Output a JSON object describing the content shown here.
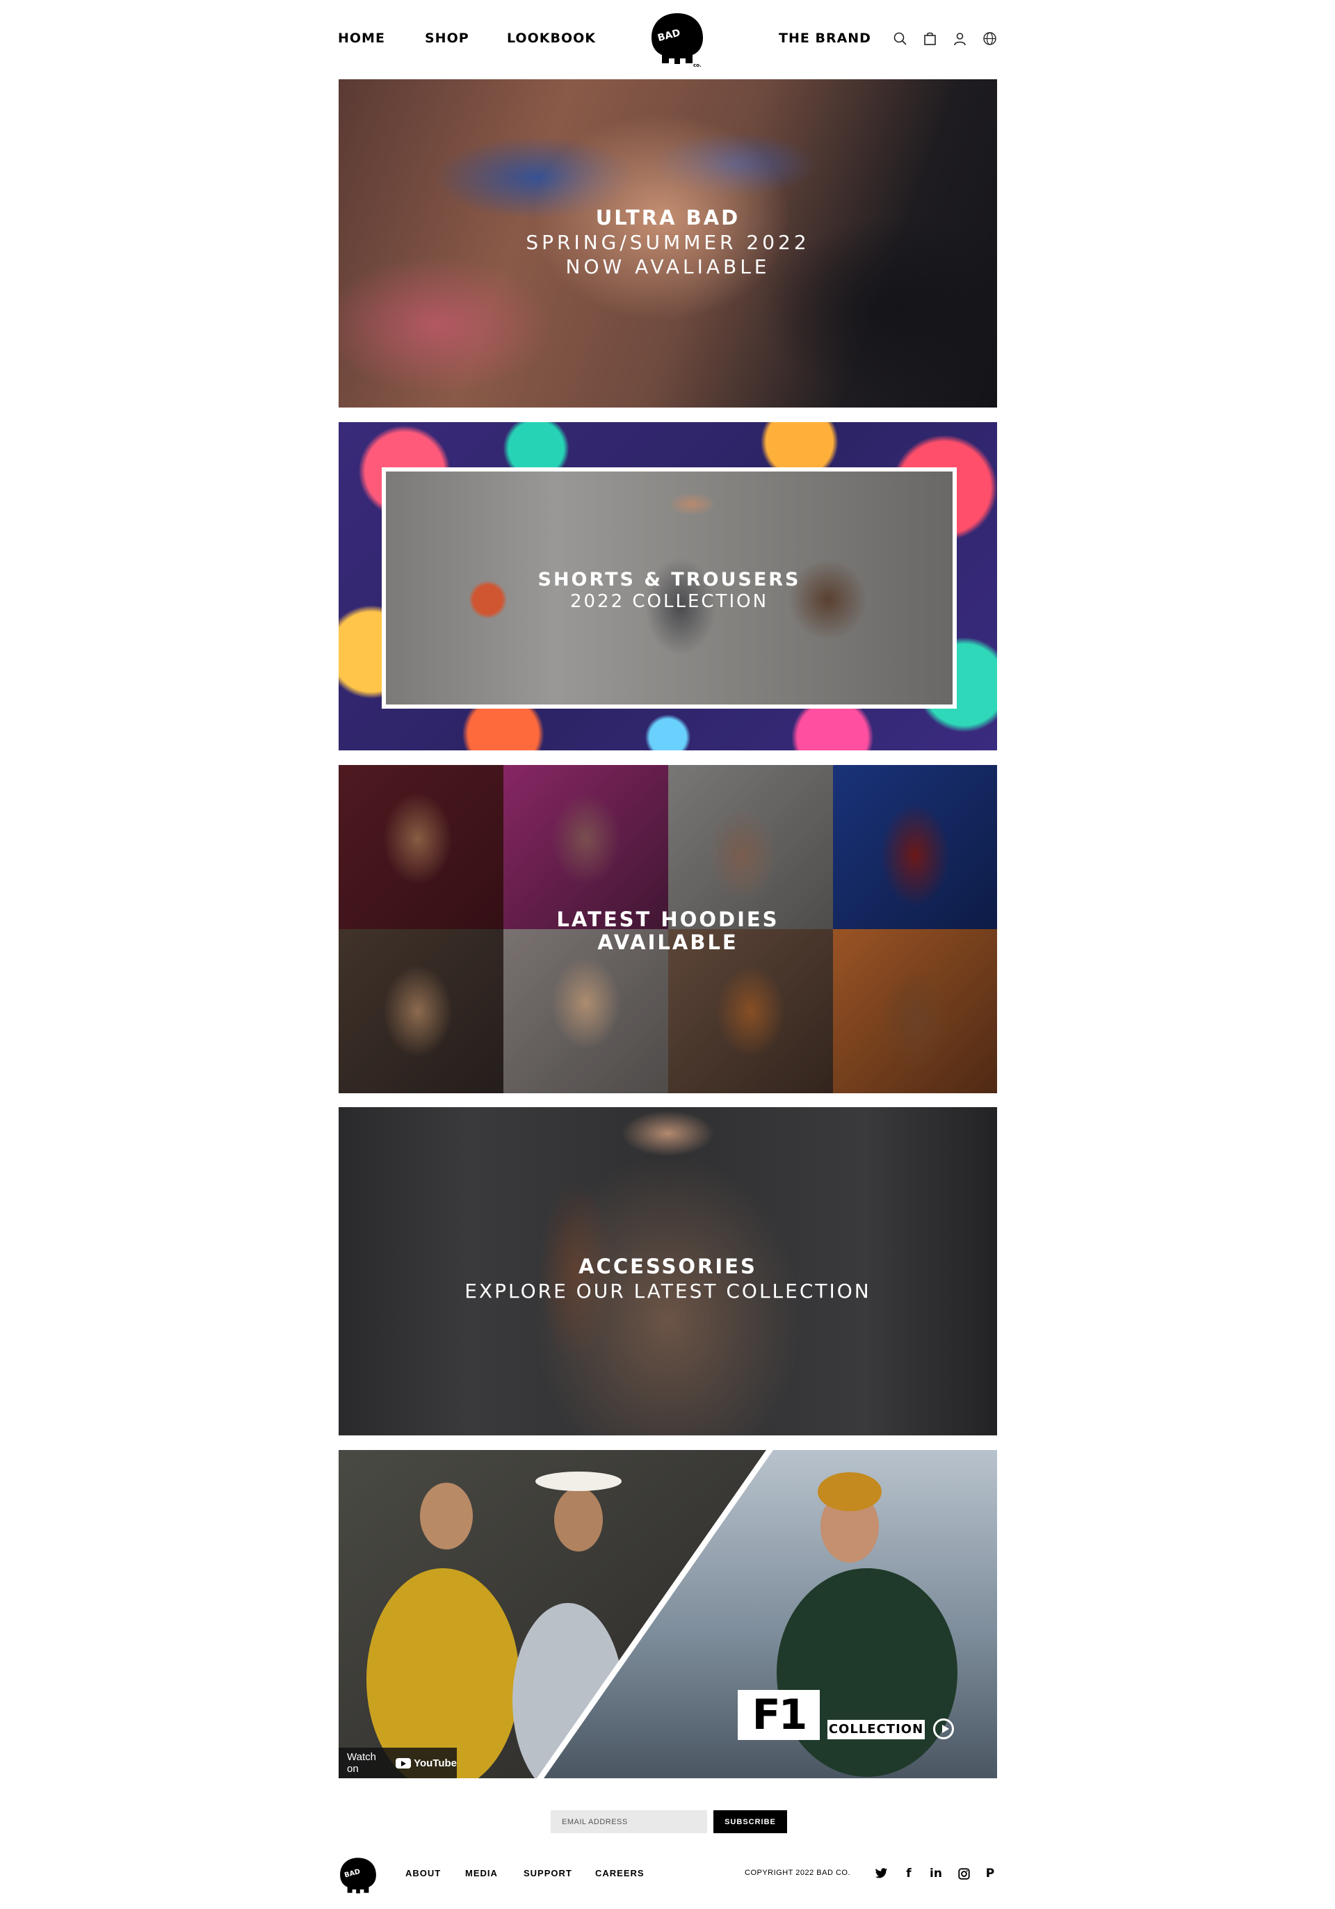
{
  "nav": {
    "home": "HOME",
    "shop": "SHOP",
    "lookbook": "LOOKBOOK",
    "brand": "THE BRAND",
    "logo_text": "BAD",
    "logo_small": "co.",
    "icons": [
      "search-icon",
      "bag-icon",
      "user-icon",
      "globe-icon"
    ]
  },
  "hero": {
    "title": "ULTRA BAD",
    "subtitle_line1": "SPRING/SUMMER 2022",
    "subtitle_line2": "NOW AVALIABLE"
  },
  "shorts": {
    "title": "SHORTS & TROUSERS",
    "subtitle": "2022 COLLECTION"
  },
  "hoodies": {
    "title_line1": "LATEST HOODIES",
    "title_line2": "AVAILABLE"
  },
  "accessories": {
    "title": "ACCESSORIES",
    "subtitle": "EXPLORE OUR LATEST COLLECTION"
  },
  "f1": {
    "logo": "F1",
    "label": "COLLECTION",
    "watch_on": "Watch on",
    "youtube": "YouTube"
  },
  "newsletter": {
    "placeholder": "EMAIL ADDRESS",
    "button": "SUBSCRIBE"
  },
  "footer": {
    "links": [
      "ABOUT",
      "MEDIA",
      "SUPPORT",
      "CAREERS"
    ],
    "copyright": "COPYRIGHT 2022 BAD CO.",
    "social": [
      "twitter-icon",
      "facebook-icon",
      "linkedin-icon",
      "instagram-icon",
      "pinterest-icon"
    ],
    "social_glyphs": {
      "facebook": "f",
      "linkedin": "in",
      "pinterest": "P"
    }
  },
  "colors": {
    "text": "#000000",
    "background": "#ffffff",
    "overlay_text": "#ffffff",
    "input_bg": "#e9e9e9"
  }
}
